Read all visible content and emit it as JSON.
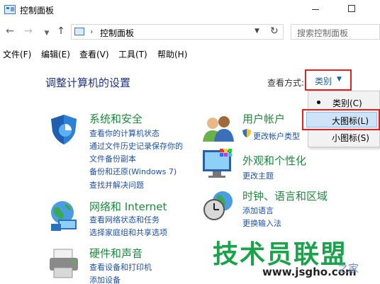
{
  "window": {
    "title": "控制面板"
  },
  "nav": {
    "address": "控制面板",
    "search_placeholder": "搜索控制面板"
  },
  "menu": [
    "文件(F)",
    "编辑(E)",
    "查看(V)",
    "工具(T)",
    "帮助(H)"
  ],
  "main": {
    "title": "调整计算机的设置",
    "view_by_label": "查看方式:",
    "view_by_value": "类别"
  },
  "dropdown": {
    "items": [
      "类别(C)",
      "大图标(L)",
      "小图标(S)"
    ],
    "selected": "类别(C)"
  },
  "categories": [
    {
      "title": "系统和安全",
      "links": [
        "查看你的计算机状态",
        "通过文件历史记录保存你的",
        "文件备份副本",
        "备份和还原(Windows 7)",
        "查找并解决问题"
      ]
    },
    {
      "title": "网络和 Internet",
      "links": [
        "查看网络状态和任务",
        "选择家庭组和共享选项"
      ]
    },
    {
      "title": "硬件和声音",
      "links": [
        "查看设备和打印机",
        "添加设备"
      ]
    },
    {
      "title": "用户帐户",
      "links": [
        "更改帐户类型"
      ]
    },
    {
      "title": "外观和个性化",
      "links": [
        "更改主题"
      ]
    },
    {
      "title": "时钟、语言和区域",
      "links": [
        "添加语言",
        "更换输入法"
      ]
    }
  ],
  "watermark": {
    "main": "技术员联盟",
    "url": "www.jsgho.com",
    "url2": "之家"
  }
}
